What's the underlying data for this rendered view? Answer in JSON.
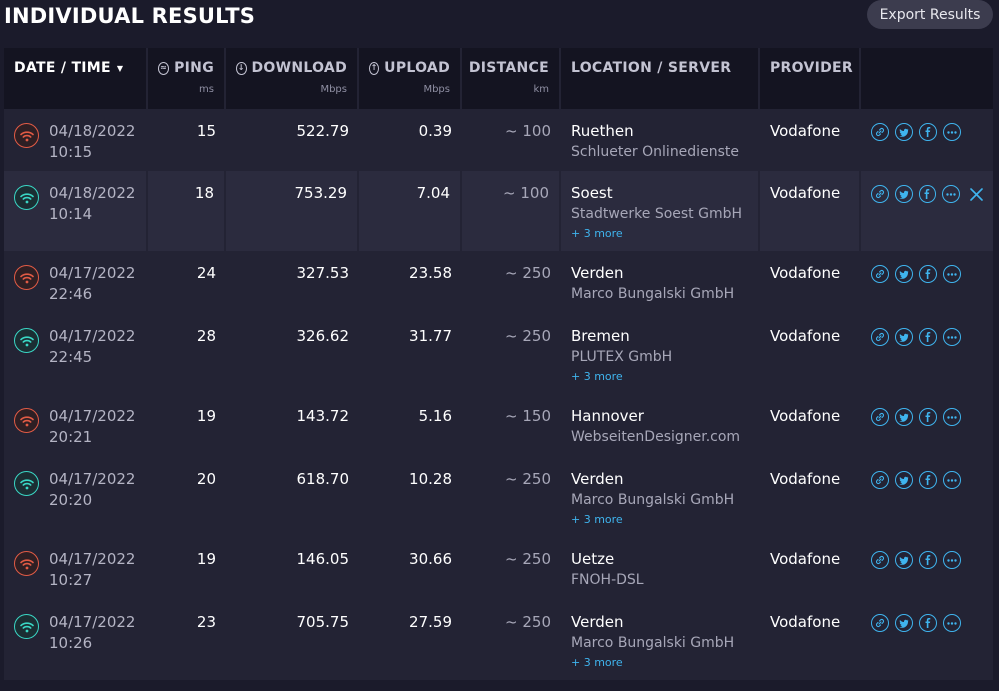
{
  "title": "INDIVIDUAL RESULTS",
  "export_label": "Export Results",
  "columns": [
    {
      "label": "DATE / TIME",
      "unit": ""
    },
    {
      "label": "PING",
      "unit": "ms"
    },
    {
      "label": "DOWNLOAD",
      "unit": "Mbps"
    },
    {
      "label": "UPLOAD",
      "unit": "Mbps"
    },
    {
      "label": "DISTANCE",
      "unit": "km"
    },
    {
      "label": "LOCATION / SERVER",
      "unit": ""
    },
    {
      "label": "PROVIDER",
      "unit": ""
    }
  ],
  "colors": {
    "wifi_orange": "#e25b45",
    "wifi_teal": "#3ad7c5",
    "action_blue": "#3fb4ee"
  },
  "rows": [
    {
      "date": "04/18/2022",
      "time": "10:15",
      "ping": "15",
      "download": "522.79",
      "upload": "0.39",
      "distance": "~ 100",
      "city": "Ruethen",
      "server": "Schlueter Onlinedienste",
      "more": "",
      "provider": "Vodafone",
      "wifi": "orange",
      "selected": false
    },
    {
      "date": "04/18/2022",
      "time": "10:14",
      "ping": "18",
      "download": "753.29",
      "upload": "7.04",
      "distance": "~ 100",
      "city": "Soest",
      "server": "Stadtwerke Soest GmbH",
      "more": "+ 3 more",
      "provider": "Vodafone",
      "wifi": "teal",
      "selected": true
    },
    {
      "date": "04/17/2022",
      "time": "22:46",
      "ping": "24",
      "download": "327.53",
      "upload": "23.58",
      "distance": "~ 250",
      "city": "Verden",
      "server": "Marco Bungalski GmbH",
      "more": "",
      "provider": "Vodafone",
      "wifi": "orange",
      "selected": false
    },
    {
      "date": "04/17/2022",
      "time": "22:45",
      "ping": "28",
      "download": "326.62",
      "upload": "31.77",
      "distance": "~ 250",
      "city": "Bremen",
      "server": "PLUTEX GmbH",
      "more": "+ 3 more",
      "provider": "Vodafone",
      "wifi": "teal",
      "selected": false
    },
    {
      "date": "04/17/2022",
      "time": "20:21",
      "ping": "19",
      "download": "143.72",
      "upload": "5.16",
      "distance": "~ 150",
      "city": "Hannover",
      "server": "WebseitenDesigner.com",
      "more": "",
      "provider": "Vodafone",
      "wifi": "orange",
      "selected": false
    },
    {
      "date": "04/17/2022",
      "time": "20:20",
      "ping": "20",
      "download": "618.70",
      "upload": "10.28",
      "distance": "~ 250",
      "city": "Verden",
      "server": "Marco Bungalski GmbH",
      "more": "+ 3 more",
      "provider": "Vodafone",
      "wifi": "teal",
      "selected": false
    },
    {
      "date": "04/17/2022",
      "time": "10:27",
      "ping": "19",
      "download": "146.05",
      "upload": "30.66",
      "distance": "~ 250",
      "city": "Uetze",
      "server": "FNOH-DSL",
      "more": "",
      "provider": "Vodafone",
      "wifi": "orange",
      "selected": false
    },
    {
      "date": "04/17/2022",
      "time": "10:26",
      "ping": "23",
      "download": "705.75",
      "upload": "27.59",
      "distance": "~ 250",
      "city": "Verden",
      "server": "Marco Bungalski GmbH",
      "more": "+ 3 more",
      "provider": "Vodafone",
      "wifi": "teal",
      "selected": false
    }
  ],
  "row_actions": [
    "link-icon",
    "twitter-icon",
    "facebook-icon",
    "more-options-icon"
  ]
}
